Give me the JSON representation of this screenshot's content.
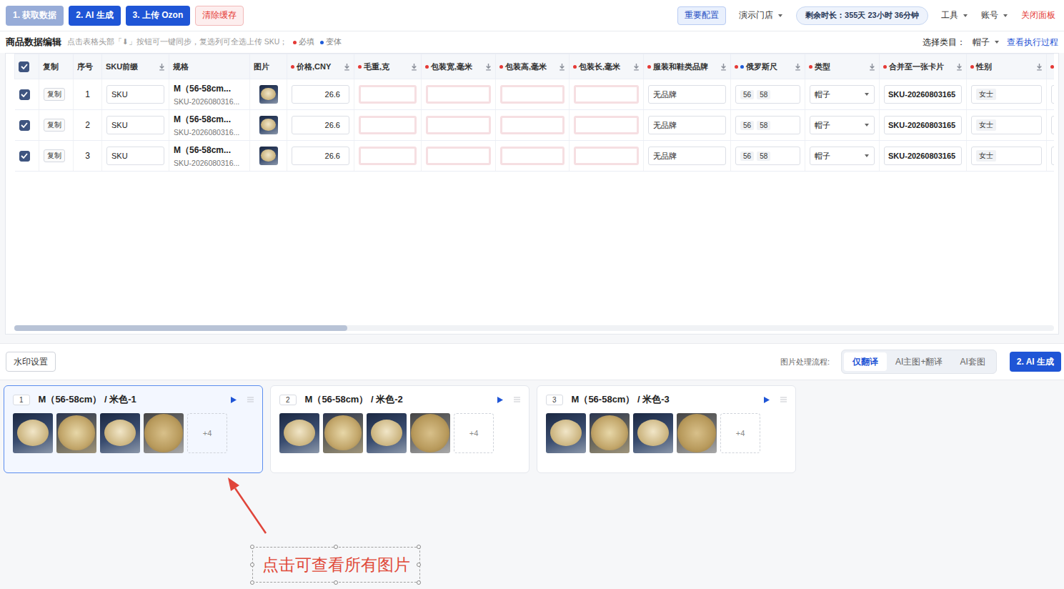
{
  "toolbar": {
    "buttons": [
      {
        "label": "1. 获取数据",
        "kind": "primary",
        "disabled": true
      },
      {
        "label": "2. AI 生成",
        "kind": "primary",
        "disabled": false
      },
      {
        "label": "3. 上传 Ozon",
        "kind": "primary",
        "disabled": false
      },
      {
        "label": "清除缓存",
        "kind": "danger",
        "disabled": false
      }
    ],
    "config": "重要配置",
    "store": "演示门店",
    "remaining": "剩余时长：355天 23小时 36分钟",
    "menus": [
      "工具",
      "账号"
    ],
    "close": "关闭面板"
  },
  "editor": {
    "title": "商品数据编辑",
    "hint": "点击表格头部「⬇」按钮可一键同步，复选列可全选上传 SKU；",
    "legend": [
      {
        "label": "必填",
        "color": "#e53935"
      },
      {
        "label": "变体",
        "color": "#1e5bd8"
      }
    ],
    "category_label": "选择类目：",
    "category": "帽子",
    "log_link": "查看执行过程"
  },
  "table": {
    "columns": [
      {
        "kind": "checkbox",
        "checked": true
      },
      {
        "kind": "label",
        "label": "复制",
        "required": false,
        "variant": false,
        "sync": false
      },
      {
        "kind": "label",
        "label": "序号",
        "required": false,
        "variant": false,
        "sync": false
      },
      {
        "kind": "label",
        "label": "SKU前缀",
        "required": false,
        "variant": false,
        "sync": true
      },
      {
        "kind": "label",
        "label": "规格",
        "required": false,
        "variant": false,
        "sync": false
      },
      {
        "kind": "label",
        "label": "图片",
        "required": false,
        "variant": false,
        "sync": false
      },
      {
        "kind": "label",
        "label": "价格,CNY",
        "required": true,
        "variant": false,
        "sync": true
      },
      {
        "kind": "label",
        "label": "毛重,克",
        "required": true,
        "variant": false,
        "sync": true
      },
      {
        "kind": "label",
        "label": "包装宽,毫米",
        "required": true,
        "variant": false,
        "sync": true
      },
      {
        "kind": "label",
        "label": "包装高,毫米",
        "required": true,
        "variant": false,
        "sync": true
      },
      {
        "kind": "label",
        "label": "包装长,毫米",
        "required": true,
        "variant": false,
        "sync": true
      },
      {
        "kind": "label",
        "label": "服装和鞋类品牌",
        "required": true,
        "variant": false,
        "sync": true
      },
      {
        "kind": "label",
        "label": "俄罗斯尺",
        "required": true,
        "variant": true,
        "sync": true
      },
      {
        "kind": "label",
        "label": "类型",
        "required": true,
        "variant": false,
        "sync": true
      },
      {
        "kind": "label",
        "label": "合并至一张卡片",
        "required": true,
        "variant": false,
        "sync": true
      },
      {
        "kind": "label",
        "label": "性别",
        "required": true,
        "variant": false,
        "sync": true
      },
      {
        "kind": "label",
        "label": "",
        "required": true,
        "variant": true,
        "sync": false
      }
    ],
    "rows": [
      {
        "cells": [
          {
            "kind": "checkbox",
            "checked": true
          },
          {
            "kind": "button",
            "text": "复制"
          },
          {
            "kind": "text",
            "text": "1"
          },
          {
            "kind": "input",
            "text": "SKU",
            "invalid": false
          },
          {
            "kind": "spec",
            "text": "M（56-58cm...",
            "sub": "SKU-2026080316..."
          },
          {
            "kind": "image"
          },
          {
            "kind": "number",
            "text": "26.6",
            "invalid": false
          },
          {
            "kind": "input",
            "text": "",
            "invalid": true
          },
          {
            "kind": "input",
            "text": "",
            "invalid": true
          },
          {
            "kind": "input",
            "text": "",
            "invalid": true
          },
          {
            "kind": "input",
            "text": "",
            "invalid": true
          },
          {
            "kind": "input",
            "text": "无品牌",
            "invalid": false
          },
          {
            "kind": "tags",
            "tags": [
              "56",
              "58"
            ]
          },
          {
            "kind": "select",
            "text": "帽子"
          },
          {
            "kind": "strong",
            "text": "SKU-20260803165"
          },
          {
            "kind": "tags",
            "tags": [
              "女士"
            ]
          },
          {
            "kind": "input",
            "text": "",
            "invalid": false
          }
        ]
      },
      {
        "cells": [
          {
            "kind": "checkbox",
            "checked": true
          },
          {
            "kind": "button",
            "text": "复制"
          },
          {
            "kind": "text",
            "text": "2"
          },
          {
            "kind": "input",
            "text": "SKU",
            "invalid": false
          },
          {
            "kind": "spec",
            "text": "M（56-58cm...",
            "sub": "SKU-2026080316..."
          },
          {
            "kind": "image"
          },
          {
            "kind": "number",
            "text": "26.6",
            "invalid": false
          },
          {
            "kind": "input",
            "text": "",
            "invalid": true
          },
          {
            "kind": "input",
            "text": "",
            "invalid": true
          },
          {
            "kind": "input",
            "text": "",
            "invalid": true
          },
          {
            "kind": "input",
            "text": "",
            "invalid": true
          },
          {
            "kind": "input",
            "text": "无品牌",
            "invalid": false
          },
          {
            "kind": "tags",
            "tags": [
              "56",
              "58"
            ]
          },
          {
            "kind": "select",
            "text": "帽子"
          },
          {
            "kind": "strong",
            "text": "SKU-20260803165"
          },
          {
            "kind": "tags",
            "tags": [
              "女士"
            ]
          },
          {
            "kind": "input",
            "text": "",
            "invalid": false
          }
        ]
      },
      {
        "cells": [
          {
            "kind": "checkbox",
            "checked": true
          },
          {
            "kind": "button",
            "text": "复制"
          },
          {
            "kind": "text",
            "text": "3"
          },
          {
            "kind": "input",
            "text": "SKU",
            "invalid": false
          },
          {
            "kind": "spec",
            "text": "M（56-58cm...",
            "sub": "SKU-2026080316..."
          },
          {
            "kind": "image"
          },
          {
            "kind": "number",
            "text": "26.6",
            "invalid": false
          },
          {
            "kind": "input",
            "text": "",
            "invalid": true
          },
          {
            "kind": "input",
            "text": "",
            "invalid": true
          },
          {
            "kind": "input",
            "text": "",
            "invalid": true
          },
          {
            "kind": "input",
            "text": "",
            "invalid": true
          },
          {
            "kind": "input",
            "text": "无品牌",
            "invalid": false
          },
          {
            "kind": "tags",
            "tags": [
              "56",
              "58"
            ]
          },
          {
            "kind": "select",
            "text": "帽子"
          },
          {
            "kind": "strong",
            "text": "SKU-20260803165"
          },
          {
            "kind": "tags",
            "tags": [
              "女士"
            ]
          },
          {
            "kind": "input",
            "text": "",
            "invalid": false
          }
        ]
      }
    ]
  },
  "scrollbar": {
    "level": 0.32
  },
  "image_bar": {
    "watermark": "水印设置",
    "flow_label": "图片处理流程:",
    "flows": [
      {
        "label": "仅翻译",
        "selected": true
      },
      {
        "label": "AI主图+翻译",
        "selected": false
      },
      {
        "label": "AI套图",
        "selected": false
      }
    ],
    "generate": "2. AI 生成"
  },
  "cards": [
    {
      "index": "1",
      "title": "M（56-58cm） / 米色-1",
      "more": "+4",
      "selected": true
    },
    {
      "index": "2",
      "title": "M（56-58cm） / 米色-2",
      "more": "+4",
      "selected": false
    },
    {
      "index": "3",
      "title": "M（56-58cm） / 米色-3",
      "more": "+4",
      "selected": false
    }
  ],
  "annotation": {
    "text": "点击可查看所有图片"
  }
}
